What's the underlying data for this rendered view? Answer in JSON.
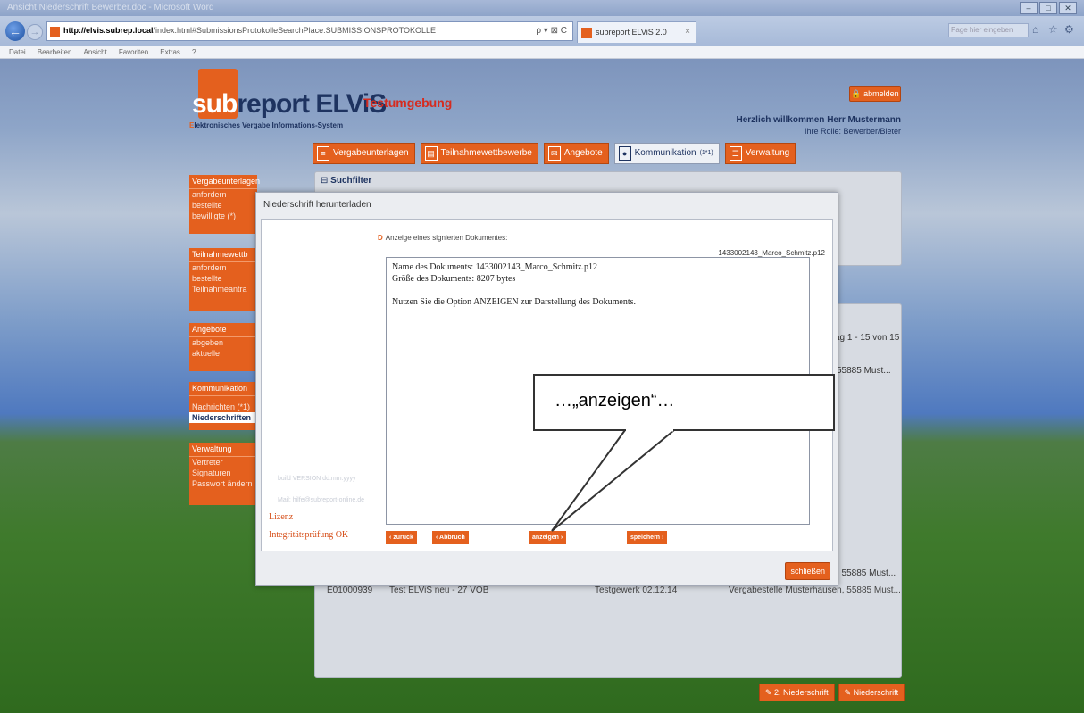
{
  "browser": {
    "window_title": "Ansicht Niederschrift Bewerber.doc - Microsoft Word",
    "url_host": "http://elvis.subrep.local",
    "url_path": "/index.html#SubmissionsProtokolleSearchPlace:SUBMISSIONSPROTOKOLLE",
    "address_controls": "ρ ▾ ⊠ C",
    "tab_label": "subreport ELViS 2.0",
    "tab_close": "×",
    "search_placeholder": "Page hier eingeben",
    "menu": [
      "Datei",
      "Bearbeiten",
      "Ansicht",
      "Favoriten",
      "Extras",
      "?"
    ],
    "window_buttons": [
      "–",
      "□",
      "✕"
    ]
  },
  "header": {
    "logo_sub": "sub",
    "logo_rest": "report ELViS",
    "tagline_prefix": "E",
    "tagline": "lektronisches Vergabe Informations-System",
    "env_label": "Testumgebung",
    "logout_label": "abmelden",
    "welcome": "Herzlich willkommen Herr Mustermann",
    "role": "Ihre Rolle: Bewerber/Bieter"
  },
  "mainnav": {
    "items": [
      {
        "label": "Vergabeunterlagen"
      },
      {
        "label": "Teilnahmewettbewerbe"
      },
      {
        "label": "Angebote"
      },
      {
        "label": "Kommunikation",
        "badge": "(1*1)"
      },
      {
        "label": "Verwaltung"
      }
    ]
  },
  "sidebar": {
    "groups": [
      {
        "title": "Vergabeunterlagen",
        "items": [
          "anfordern",
          "bestellte",
          "bewilligte (*)"
        ]
      },
      {
        "title": "Teilnahmewettb",
        "items": [
          "anfordern",
          "bestellte",
          "Teilnahmeantra"
        ]
      },
      {
        "title": "Angebote",
        "items": [
          "abgeben",
          "aktuelle"
        ]
      },
      {
        "title": "Kommunikation",
        "items": [
          "Nachrichten (*1)",
          "Niederschriften"
        ]
      },
      {
        "title": "Verwaltung",
        "items": [
          "Vertreter",
          "Signaturen",
          "Passwort ändern"
        ]
      }
    ]
  },
  "background": {
    "filter_title": "Suchfilter",
    "pager": "ag 1 - 15 von 15",
    "row_partial": "55885 Must...",
    "row_last_partial": ", 55885 Must...",
    "bottom_row": {
      "id": "E01000939",
      "title": "Test ELViS neu - 27 VOB",
      "type": "Testgewerk 02.12.14",
      "place": "Vergabestelle Musterhausen, 55885 Must..."
    },
    "bottom_buttons": [
      "2. Niederschrift",
      "Niederschrift"
    ]
  },
  "modal": {
    "title": "Niederschrift herunterladen",
    "hint": "Anzeige eines signierten Dokumentes:",
    "filename": "1433002143_Marco_Schmitz.p12",
    "doc_lines": [
      "Name des Dokuments: 1433002143_Marco_Schmitz.p12",
      "Größe des Dokuments: 8207 bytes",
      "Nutzen Sie die Option ANZEIGEN zur Darstellung des Dokuments."
    ],
    "left_faint1": "build VERSION dd.mm.yyyy",
    "left_faint2": "Mail: hilfe@subreport-online.de",
    "lizenz": "Lizenz",
    "integritaet": "Integritätsprüfung OK",
    "buttons": {
      "back": "‹ zurück",
      "abort": "‹ Abbruch",
      "show": "anzeigen ›",
      "save": "speichern ›"
    },
    "close": "schließen"
  },
  "callout": {
    "text": "…„anzeigen“…"
  },
  "colors": {
    "accent": "#e4601e",
    "navy": "#1e3360",
    "red": "#d62b1f"
  }
}
